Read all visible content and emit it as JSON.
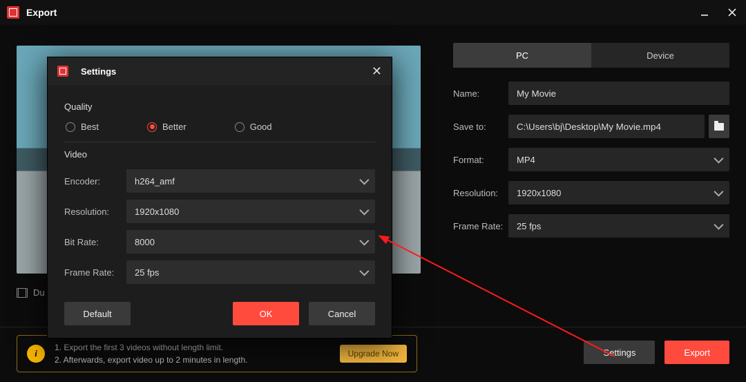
{
  "window": {
    "title": "Export"
  },
  "tabs": {
    "pc": "PC",
    "device": "Device"
  },
  "form": {
    "name_label": "Name:",
    "name_value": "My Movie",
    "saveto_label": "Save to:",
    "saveto_value": "C:\\Users\\bj\\Desktop\\My Movie.mp4",
    "format_label": "Format:",
    "format_value": "MP4",
    "resolution_label": "Resolution:",
    "resolution_value": "1920x1080",
    "framerate_label": "Frame Rate:",
    "framerate_value": "25 fps"
  },
  "duration_label_prefix": "Du",
  "upgrade": {
    "line1": "1. Export the first 3 videos without length limit.",
    "line2": "2. Afterwards, export video up to 2 minutes in length.",
    "button": "Upgrade Now"
  },
  "actions": {
    "settings": "Settings",
    "export": "Export"
  },
  "modal": {
    "title": "Settings",
    "quality_label": "Quality",
    "quality_options": {
      "best": "Best",
      "better": "Better",
      "good": "Good"
    },
    "quality_selected": "better",
    "video_label": "Video",
    "encoder_label": "Encoder:",
    "encoder_value": "h264_amf",
    "resolution_label": "Resolution:",
    "resolution_value": "1920x1080",
    "bitrate_label": "Bit Rate:",
    "bitrate_value": "8000",
    "framerate_label": "Frame Rate:",
    "framerate_value": "25 fps",
    "buttons": {
      "default": "Default",
      "ok": "OK",
      "cancel": "Cancel"
    }
  }
}
